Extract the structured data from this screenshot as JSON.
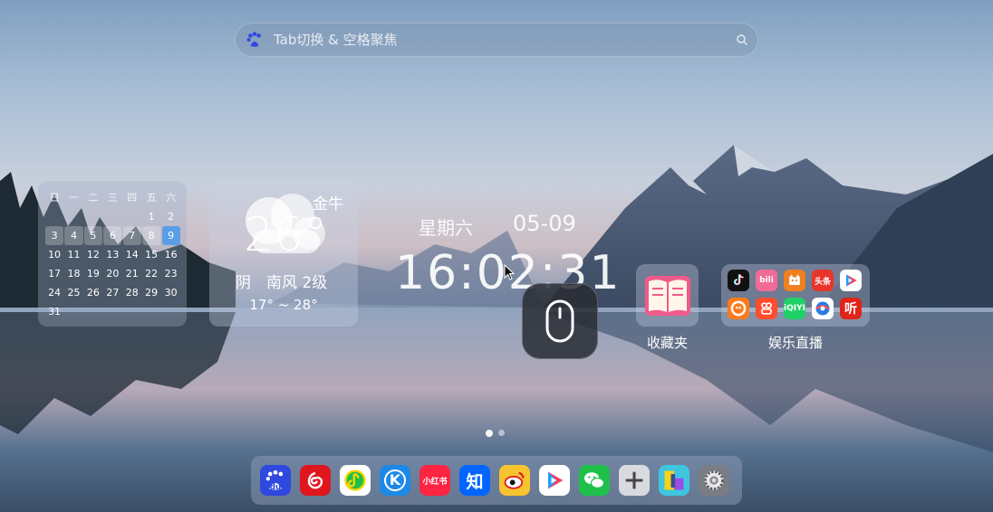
{
  "search": {
    "placeholder": "Tab切换 & 空格聚焦"
  },
  "calendar": {
    "weekdays": [
      "日",
      "一",
      "二",
      "三",
      "四",
      "五",
      "六"
    ],
    "rows": [
      [
        "",
        "",
        "",
        "",
        "",
        "1",
        "2"
      ],
      [
        "3",
        "4",
        "5",
        "6",
        "7",
        "8",
        "9"
      ],
      [
        "10",
        "11",
        "12",
        "13",
        "14",
        "15",
        "16"
      ],
      [
        "17",
        "18",
        "19",
        "20",
        "21",
        "22",
        "23"
      ],
      [
        "24",
        "25",
        "26",
        "27",
        "28",
        "29",
        "30"
      ],
      [
        "31",
        "",
        "",
        "",
        "",
        "",
        ""
      ]
    ],
    "today": "9"
  },
  "weather": {
    "city": "金牛",
    "temp": "26°",
    "condition": "阴　南风 2级",
    "range": "17° ~ 28°"
  },
  "clock": {
    "weekday": "星期六",
    "date": "05-09",
    "time": "16:02:31"
  },
  "favorites": {
    "label": "收藏夹"
  },
  "entertainment": {
    "label": "娱乐直播",
    "apps": [
      {
        "icon": "douyin-icon",
        "text": "",
        "color": "#111111"
      },
      {
        "icon": "bilibili-icon",
        "text": "bili",
        "color": "#f06c96"
      },
      {
        "icon": "tmall-cat-icon",
        "text": "",
        "color": "#f08020"
      },
      {
        "icon": "toutiao-icon",
        "text": "头条",
        "color": "#e8352b"
      },
      {
        "icon": "tencent-video-icon",
        "text": "",
        "color": "#ffffff"
      },
      {
        "icon": "kuaishou-icon",
        "text": "",
        "color": "#ff7a1a"
      },
      {
        "icon": "duoduo-icon",
        "text": "",
        "color": "#ff4d2d"
      },
      {
        "icon": "iqiyi-icon",
        "text": "iQIYI",
        "color": "#1fd067"
      },
      {
        "icon": "huya-icon",
        "text": "",
        "color": "#ffffff"
      },
      {
        "icon": "ting-icon",
        "text": "听",
        "color": "#e2231a"
      }
    ]
  },
  "dock": {
    "apps": [
      {
        "icon": "baidu-icon",
        "text": "du",
        "color": "#2f48e0"
      },
      {
        "icon": "netease-music-icon",
        "text": "",
        "color": "#e0161e"
      },
      {
        "icon": "qq-music-icon",
        "text": "",
        "color": "#ffffff"
      },
      {
        "icon": "kugou-icon",
        "text": "K",
        "color": "#1e88e5"
      },
      {
        "icon": "xiaohongshu-icon",
        "text": "小红书",
        "color": "#ff2442"
      },
      {
        "icon": "zhihu-icon",
        "text": "知",
        "color": "#0066ff"
      },
      {
        "icon": "weibo-icon",
        "text": "",
        "color": "#f7c32e"
      },
      {
        "icon": "tencent-video-icon",
        "text": "",
        "color": "#ffffff"
      },
      {
        "icon": "wechat-icon",
        "text": "",
        "color": "#1fc04a"
      },
      {
        "icon": "add-icon",
        "text": "",
        "color": "#d8dadf"
      },
      {
        "icon": "theme-icon",
        "text": "",
        "color": "#3ec6e0"
      },
      {
        "icon": "settings-icon",
        "text": "",
        "color": "#7a7d84"
      }
    ]
  }
}
